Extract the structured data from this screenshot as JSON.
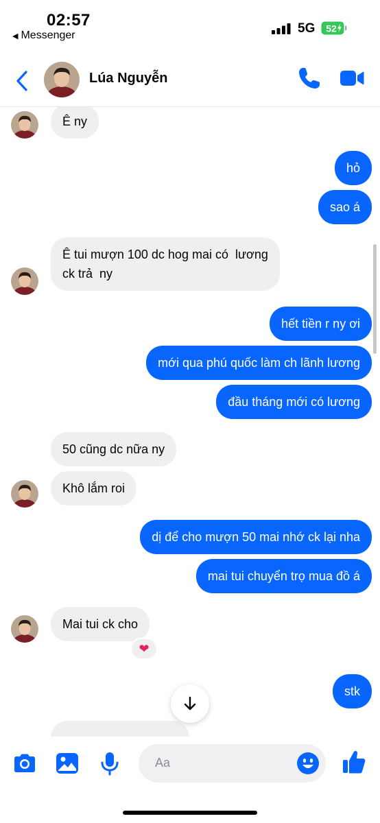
{
  "status_bar": {
    "time": "02:57",
    "back_app": "Messenger",
    "network": "5G",
    "battery": "52"
  },
  "header": {
    "contact_name": "Lúa Nguyễn",
    "icons": [
      "chevron-left-icon",
      "phone-icon",
      "video-camera-icon"
    ]
  },
  "messages": [
    {
      "from": "them",
      "text": "Ê ny"
    },
    {
      "from": "me",
      "text": "hỏ"
    },
    {
      "from": "me",
      "text": "sao á"
    },
    {
      "from": "them",
      "text": "Ê tui mượn 100 dc hog mai có  lương",
      "text2": "ck trả  ny"
    },
    {
      "from": "me",
      "text": "hết tiền r ny ơi"
    },
    {
      "from": "me",
      "text": "mới qua phú quốc làm ch lãnh lương"
    },
    {
      "from": "me",
      "text": "đầu tháng mới có lương"
    },
    {
      "from": "them",
      "text": "50 cũng dc nữa ny"
    },
    {
      "from": "them",
      "text": "Khô lắm roi"
    },
    {
      "from": "me",
      "text": "dị để cho mượn 50 mai nhớ ck lại nha"
    },
    {
      "from": "me",
      "text": "mai tui chuyển trọ mua đồ á"
    },
    {
      "from": "them",
      "text": "Mai tui ck cho",
      "reaction": "heart"
    },
    {
      "from": "me",
      "text": "stk"
    }
  ],
  "composer": {
    "placeholder": "Aa",
    "icons": [
      "camera-icon",
      "photo-icon",
      "microphone-icon",
      "emoji-icon",
      "thumbs-up-icon"
    ]
  },
  "colors": {
    "accent": "#0866ff",
    "incoming_bubble": "#efeff2"
  }
}
